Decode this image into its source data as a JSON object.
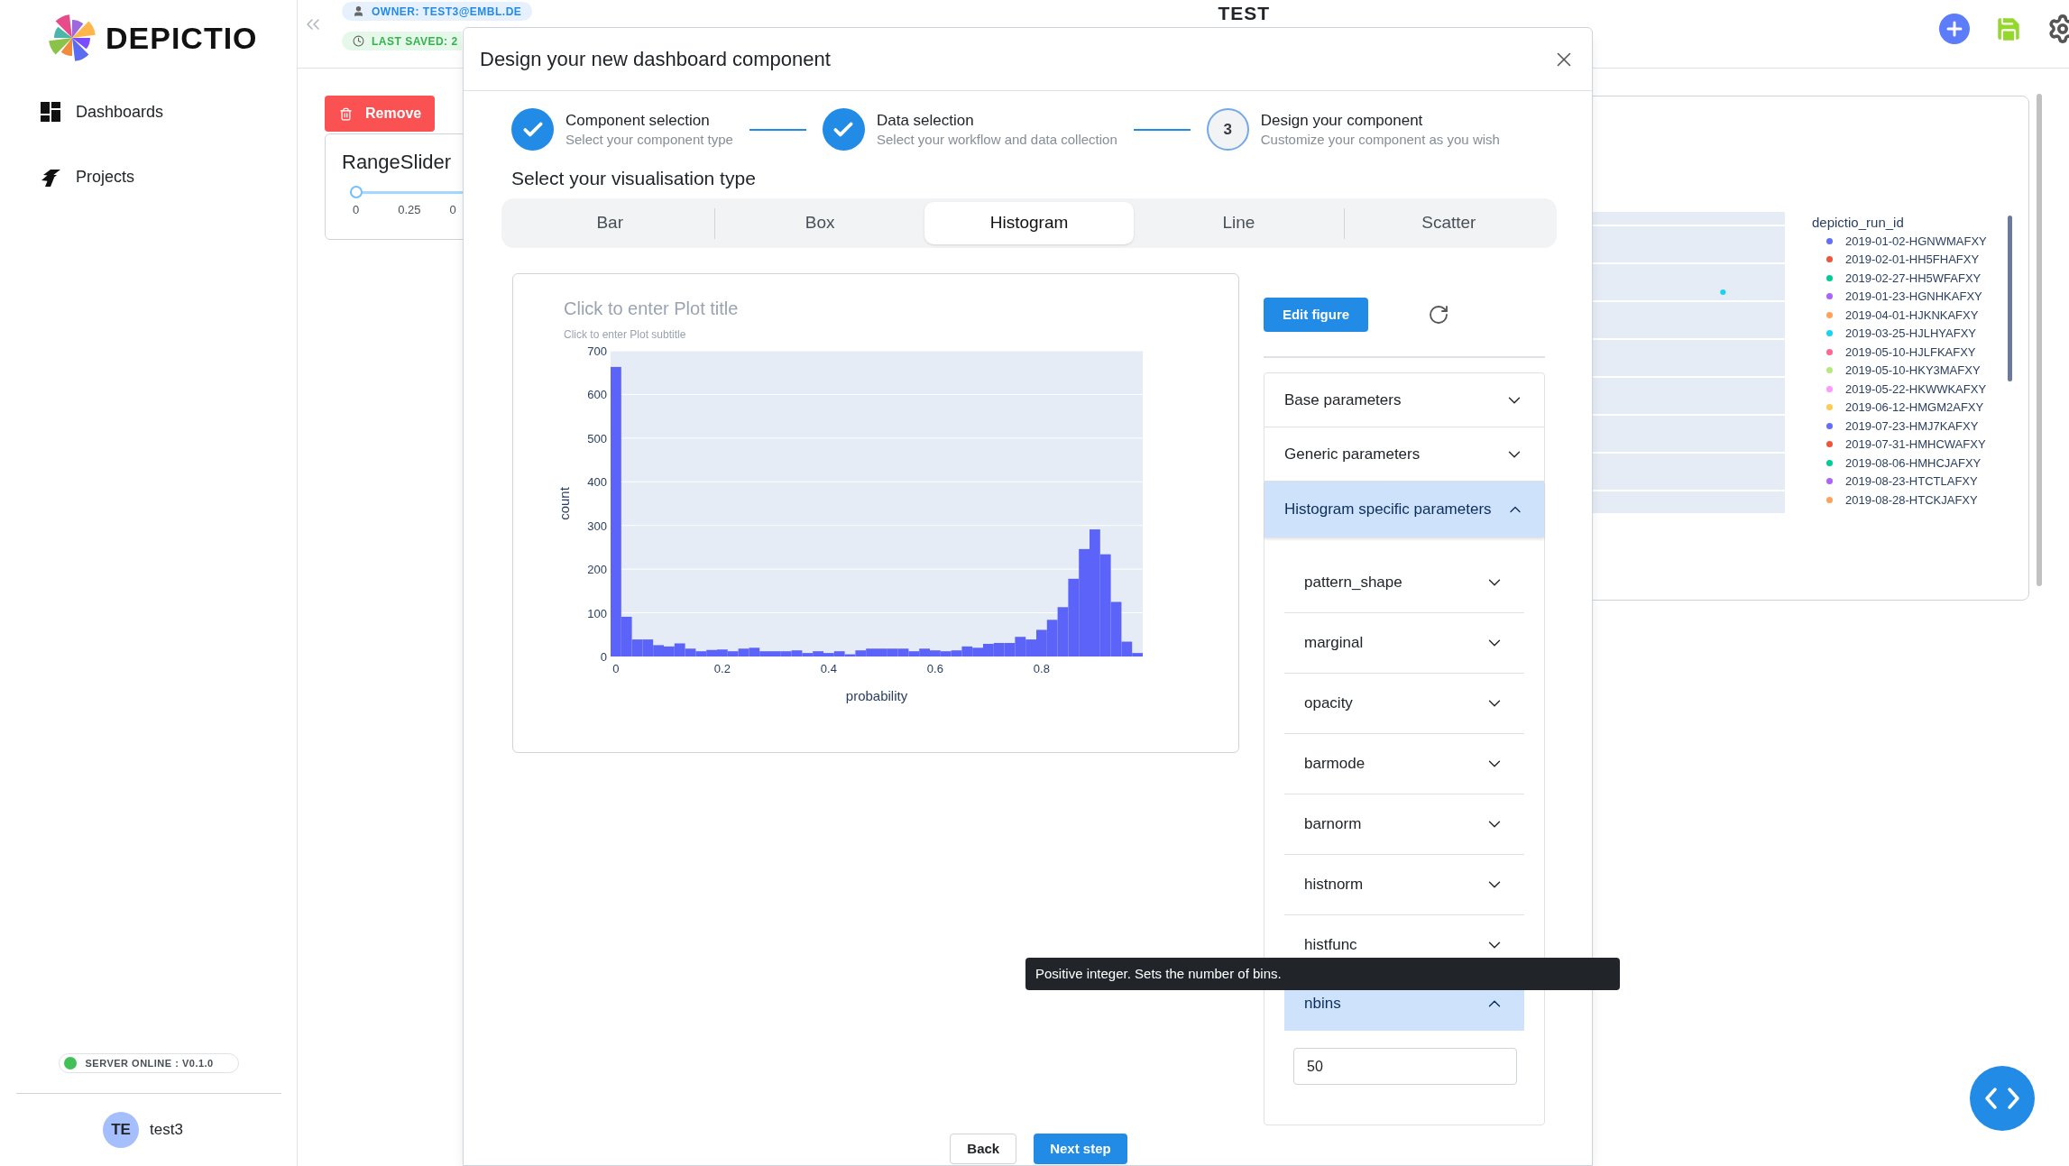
{
  "sidebar": {
    "logo_text": "DEPICTIO",
    "nav": [
      {
        "label": "Dashboards",
        "selected": false
      },
      {
        "label": "Projects",
        "selected": false
      }
    ],
    "server_status": {
      "label": "SERVER ONLINE : V0.1.0",
      "online": true
    },
    "user": {
      "initials": "TE",
      "name": "test3"
    }
  },
  "header": {
    "owner": "OWNER: TEST3@EMBL.DE",
    "last_saved": "LAST SAVED: 2",
    "title": "TEST"
  },
  "background": {
    "remove_button": "Remove",
    "range_slider": {
      "title": "RangeSlider",
      "level": 0,
      "ticks": [
        "0",
        "0.25",
        "0"
      ]
    },
    "legend": {
      "title": "depictio_run_id",
      "items": [
        {
          "label": "2019-01-02-HGNWMAFXY",
          "color": "#636efa"
        },
        {
          "label": "2019-02-01-HH5FHAFXY",
          "color": "#ef553b"
        },
        {
          "label": "2019-02-27-HH5WFAFXY",
          "color": "#00cc96"
        },
        {
          "label": "2019-01-23-HGNHKAFXY",
          "color": "#ab63fa"
        },
        {
          "label": "2019-04-01-HJKNKAFXY",
          "color": "#ffa15a"
        },
        {
          "label": "2019-03-25-HJLHYAFXY",
          "color": "#19d3f3"
        },
        {
          "label": "2019-05-10-HJLFKAFXY",
          "color": "#ff6692"
        },
        {
          "label": "2019-05-10-HKY3MAFXY",
          "color": "#b6e880"
        },
        {
          "label": "2019-05-22-HKWWKAFXY",
          "color": "#ff97ff"
        },
        {
          "label": "2019-06-12-HMGM2AFXY",
          "color": "#fecb52"
        },
        {
          "label": "2019-07-23-HMJ7KAFXY",
          "color": "#636efa"
        },
        {
          "label": "2019-07-31-HMHCWAFXY",
          "color": "#ef553b"
        },
        {
          "label": "2019-08-06-HMHCJAFXY",
          "color": "#00cc96"
        },
        {
          "label": "2019-08-23-HTCTLAFXY",
          "color": "#ab63fa"
        },
        {
          "label": "2019-08-28-HTCKJAFXY",
          "color": "#ffa15a"
        }
      ]
    }
  },
  "modal": {
    "title": "Design your new dashboard component",
    "steps": [
      {
        "title": "Component selection",
        "subtitle": "Select your component type",
        "completed": true
      },
      {
        "title": "Data selection",
        "subtitle": "Select your workflow and data collection",
        "completed": true
      },
      {
        "title": "Design your component",
        "subtitle": "Customize your component as you wish",
        "completed": false,
        "number": "3"
      }
    ],
    "section_heading": "Select your visualisation type",
    "tabs": [
      {
        "label": "Bar",
        "selected": false
      },
      {
        "label": "Box",
        "selected": false
      },
      {
        "label": "Histogram",
        "selected": true
      },
      {
        "label": "Line",
        "selected": false
      },
      {
        "label": "Scatter",
        "selected": false
      }
    ],
    "plot": {
      "title_placeholder": "Click to enter Plot title",
      "subtitle_placeholder": "Click to enter Plot subtitle",
      "chart_data": {
        "type": "bar",
        "grid": true,
        "xlabel": "probability",
        "ylabel": "count",
        "x": [
          0,
          0.02,
          0.04,
          0.06,
          0.08,
          0.1,
          0.12,
          0.14,
          0.16,
          0.18,
          0.2,
          0.22,
          0.24,
          0.26,
          0.28,
          0.3,
          0.32,
          0.34,
          0.36,
          0.38,
          0.4,
          0.42,
          0.44,
          0.46,
          0.48,
          0.5,
          0.52,
          0.54,
          0.56,
          0.58,
          0.6,
          0.62,
          0.64,
          0.66,
          0.68,
          0.7,
          0.72,
          0.74,
          0.76,
          0.78,
          0.8,
          0.82,
          0.84,
          0.86,
          0.88,
          0.9,
          0.92,
          0.94,
          0.96,
          0.98
        ],
        "values": [
          663,
          91,
          39,
          39,
          26,
          23,
          30,
          18,
          12,
          15,
          16,
          12,
          18,
          20,
          12,
          12,
          12,
          14,
          8,
          12,
          8,
          12,
          5,
          14,
          18,
          18,
          18,
          18,
          12,
          18,
          14,
          12,
          14,
          23,
          20,
          29,
          31,
          31,
          45,
          39,
          61,
          84,
          113,
          178,
          246,
          291,
          234,
          125,
          34,
          8
        ],
        "xlim": [
          -0.01,
          0.99
        ],
        "ylim": [
          0,
          700
        ],
        "xticks": [
          0,
          0.2,
          0.4,
          0.6,
          0.8
        ],
        "yticks": [
          0,
          100,
          200,
          300,
          400,
          500,
          600,
          700
        ]
      }
    },
    "edit_button": "Edit figure",
    "accordion": [
      {
        "label": "Base parameters",
        "expanded": false
      },
      {
        "label": "Generic parameters",
        "expanded": false
      },
      {
        "label": "Histogram specific parameters",
        "expanded": true,
        "params": [
          {
            "label": "pattern_shape",
            "expanded": false
          },
          {
            "label": "marginal",
            "expanded": false
          },
          {
            "label": "opacity",
            "expanded": false
          },
          {
            "label": "barmode",
            "expanded": false
          },
          {
            "label": "barnorm",
            "expanded": false
          },
          {
            "label": "histnorm",
            "expanded": false
          },
          {
            "label": "histfunc",
            "expanded": false
          },
          {
            "label": "nbins",
            "expanded": true,
            "value": "50"
          }
        ]
      }
    ],
    "tooltip": "Positive integer. Sets the number of bins.",
    "buttons": [
      "Back",
      "Next step"
    ]
  }
}
